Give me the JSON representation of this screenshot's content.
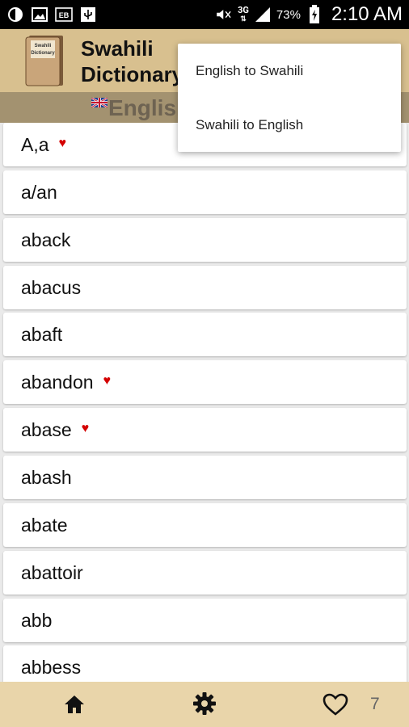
{
  "status_bar": {
    "icons": [
      "half-circle-icon",
      "image-icon",
      "ebay-icon",
      "usb-icon",
      "mute-icon",
      "signal-icon",
      "battery-icon"
    ],
    "network": "3G",
    "battery": "73%",
    "time": "2:10 AM"
  },
  "app": {
    "title_line1": "Swahili",
    "title_line2": "Dictionary",
    "logo_text_line1": "Swahili",
    "logo_text_line2": "Dictionary"
  },
  "subheader": {
    "label": "English"
  },
  "menu": {
    "items": [
      "English to Swahili",
      "Swahili to English"
    ]
  },
  "words": [
    {
      "text": "A,a",
      "favorite": true
    },
    {
      "text": "a/an",
      "favorite": false
    },
    {
      "text": "aback",
      "favorite": false
    },
    {
      "text": "abacus",
      "favorite": false
    },
    {
      "text": "abaft",
      "favorite": false
    },
    {
      "text": "abandon",
      "favorite": true
    },
    {
      "text": "abase",
      "favorite": true
    },
    {
      "text": "abash",
      "favorite": false
    },
    {
      "text": "abate",
      "favorite": false
    },
    {
      "text": "abattoir",
      "favorite": false
    },
    {
      "text": "abb",
      "favorite": false
    },
    {
      "text": "abbess",
      "favorite": false
    }
  ],
  "bottom_bar": {
    "favorites_count": "7"
  },
  "colors": {
    "action_bar": "#d8c08f",
    "sub_header": "#a39270",
    "bottom_bar": "#e9d5aa",
    "heart": "#d40000"
  }
}
